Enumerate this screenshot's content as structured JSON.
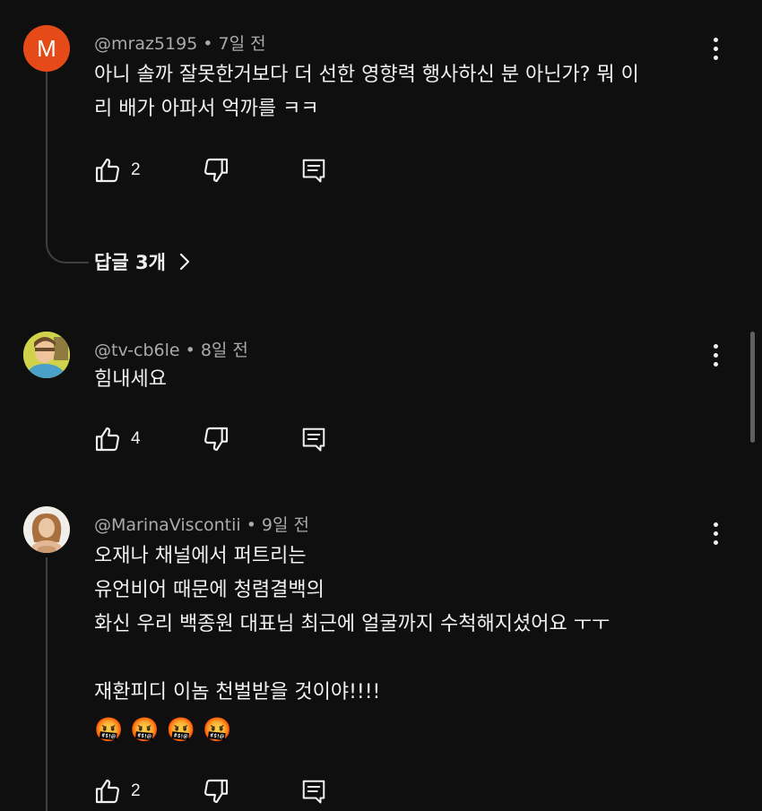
{
  "comments": [
    {
      "avatar_letter": "M",
      "handle": "@mraz5195",
      "separator": "•",
      "time": "7일 전",
      "text": "아니 솔까 잘못한거보다 더 선한 영향력 행사하신 분 아닌가? 뭐 이\n리 배가 아파서 억까를 ㅋㅋ",
      "likes": "2",
      "replies_label": "답글 3개"
    },
    {
      "handle": "@tv-cb6le",
      "separator": "•",
      "time": "8일 전",
      "text": "힘내세요",
      "likes": "4"
    },
    {
      "handle": "@MarinaViscontii",
      "separator": "•",
      "time": "9일 전",
      "text": "오재나 채널에서 퍼트리는\n유언비어 때문에 청렴결백의\n화신 우리 백종원 대표님 최근에 얼굴까지 수척해지셨어요 ㅜㅜ\n\n재환피디 이놈 천벌받을 것이야!!!!",
      "emoji": [
        "🤬",
        "🤬",
        "🤬",
        "🤬"
      ],
      "likes": "2"
    }
  ],
  "icons": {
    "like": "thumb-up-icon",
    "dislike": "thumb-down-icon",
    "reply": "comment-reply-icon",
    "more": "more-vert-icon",
    "chevron": "chevron-right-icon"
  },
  "colors": {
    "background": "#0f0f0f",
    "text": "#f1f1f1",
    "secondary_text": "#aaaaaa",
    "avatar_m": "#e64a19"
  }
}
